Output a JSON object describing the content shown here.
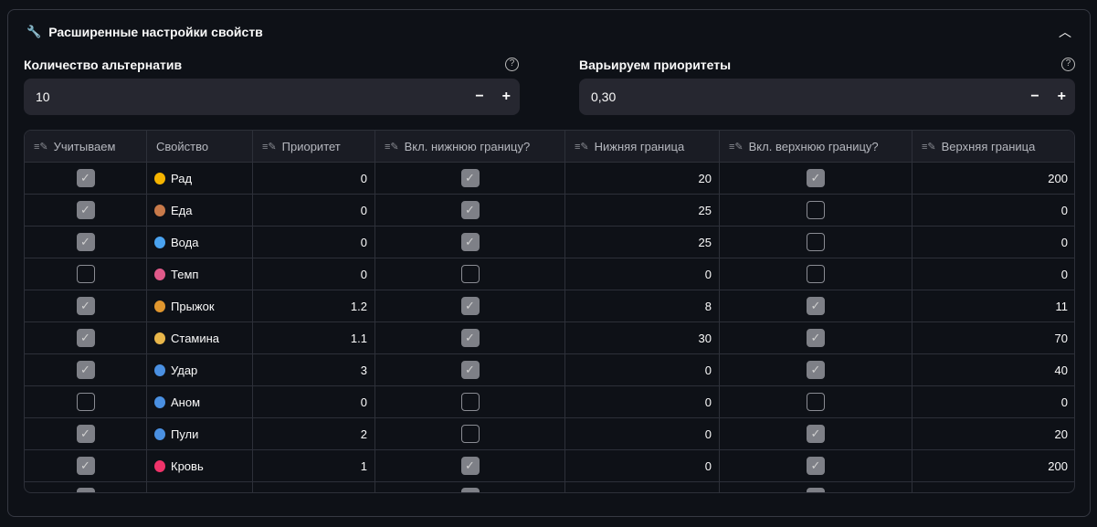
{
  "expander": {
    "title": "Расширенные настройки свойств",
    "icon": "wrench-icon"
  },
  "alternatives": {
    "label": "Количество альтернатив",
    "value": "10",
    "minus": "−",
    "plus": "+",
    "help": "?"
  },
  "priorities": {
    "label": "Варьируем приоритеты",
    "value": "0,30",
    "minus": "−",
    "plus": "+",
    "help": "?"
  },
  "table": {
    "columns": [
      "Учитываем",
      "Свойство",
      "Приоритет",
      "Вкл. нижнюю границу?",
      "Нижняя граница",
      "Вкл. верхнюю границу?",
      "Верхняя граница"
    ],
    "rows": [
      {
        "use": true,
        "name": "Рад",
        "icon": "radioactive-icon",
        "color": "#f5b400",
        "priority": "0",
        "low_on": true,
        "low": "20",
        "high_on": true,
        "high": "200"
      },
      {
        "use": true,
        "name": "Еда",
        "icon": "poultry-leg-icon",
        "color": "#c87a4a",
        "priority": "0",
        "low_on": true,
        "low": "25",
        "high_on": false,
        "high": "0"
      },
      {
        "use": true,
        "name": "Вода",
        "icon": "droplet-icon",
        "color": "#4aa3f0",
        "priority": "0",
        "low_on": true,
        "low": "25",
        "high_on": false,
        "high": "0"
      },
      {
        "use": false,
        "name": "Темп",
        "icon": "thermometer-icon",
        "color": "#e05a8a",
        "priority": "0",
        "low_on": false,
        "low": "0",
        "high_on": false,
        "high": "0"
      },
      {
        "use": true,
        "name": "Прыжок",
        "icon": "leopard-icon",
        "color": "#e0962e",
        "priority": "1.2",
        "low_on": true,
        "low": "8",
        "high_on": true,
        "high": "11"
      },
      {
        "use": true,
        "name": "Стамина",
        "icon": "runner-icon",
        "color": "#e8b64a",
        "priority": "1.1",
        "low_on": true,
        "low": "30",
        "high_on": true,
        "high": "70"
      },
      {
        "use": true,
        "name": "Удар",
        "icon": "shield-icon",
        "color": "#4a90e2",
        "priority": "3",
        "low_on": true,
        "low": "0",
        "high_on": true,
        "high": "40"
      },
      {
        "use": false,
        "name": "Аном",
        "icon": "shield-icon",
        "color": "#4a90e2",
        "priority": "0",
        "low_on": false,
        "low": "0",
        "high_on": false,
        "high": "0"
      },
      {
        "use": true,
        "name": "Пули",
        "icon": "shield-icon",
        "color": "#4a90e2",
        "priority": "2",
        "low_on": false,
        "low": "0",
        "high_on": true,
        "high": "20"
      },
      {
        "use": true,
        "name": "Кровь",
        "icon": "blood-drop-icon",
        "color": "#f0336a",
        "priority": "1",
        "low_on": true,
        "low": "0",
        "high_on": true,
        "high": "200"
      }
    ]
  }
}
